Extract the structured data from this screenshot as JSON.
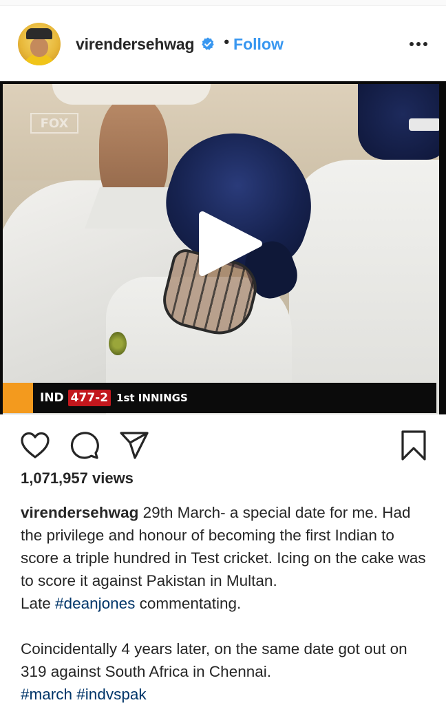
{
  "post": {
    "username": "virendersehwag",
    "verified_icon": "verified-badge-icon",
    "separator": "•",
    "follow_label": "Follow",
    "more_icon": "more-options-icon"
  },
  "video": {
    "watermark": "FOX",
    "scorebar": {
      "team": "IND",
      "score": "477-2",
      "innings": "1st INNINGS"
    },
    "play_icon": "play-icon"
  },
  "actions": {
    "like_icon": "heart-icon",
    "comment_icon": "comment-icon",
    "share_icon": "send-icon",
    "save_icon": "bookmark-icon"
  },
  "stats": {
    "views": "1,071,957 views"
  },
  "caption": {
    "user": "virendersehwag",
    "line1": " 29th March- a special date for me. Had the privilege and honour of becoming the first Indian to score a triple hundred in Test cricket. Icing on the cake was to score it against Pakistan in Multan.",
    "late_prefix": "Late ",
    "tag_deanjones": "#deanjones",
    "late_suffix": " commentating.",
    "line3": "Coincidentally 4 years later, on the same date got out on 319 against South Africa in Chennai.",
    "tag_march": "#march",
    "tag_indvspak": "#indvspak"
  },
  "colors": {
    "link_blue": "#3897f0",
    "hashtag": "#003569",
    "text": "#262626",
    "score_red": "#c3171d",
    "score_orange": "#f39a1e"
  }
}
